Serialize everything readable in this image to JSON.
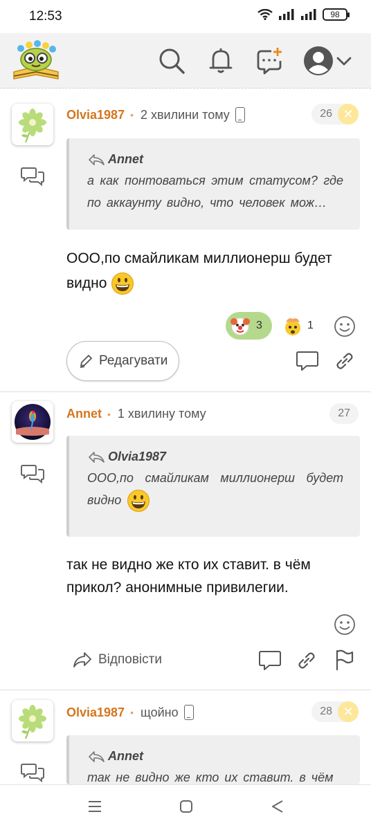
{
  "status_bar": {
    "time": "12:53",
    "battery": "98"
  },
  "header": {
    "icons": [
      "search-icon",
      "bell-icon",
      "new-post-icon",
      "account-icon",
      "chevron-down-icon"
    ]
  },
  "posts": [
    {
      "author": "Olvia1987",
      "time": "2 хвилини тому",
      "number": "26",
      "quote_author": "Annet",
      "quote_text": "а как понтоваться этим статусом? где по аккаунту видно, что человек мож…",
      "text": "ООО,по смайликам миллионерш будет видно",
      "reactions": [
        {
          "icon": "clown-face-icon",
          "count": "3"
        },
        {
          "icon": "exploding-head-icon",
          "count": "1"
        }
      ],
      "edit_label": "Редагувати"
    },
    {
      "author": "Annet",
      "time": "1 хвилину тому",
      "number": "27",
      "quote_author": "Olvia1987",
      "quote_text": "ООО,по смайликам миллионерш будет видно",
      "text": "так не видно же кто их ставит. в чём прикол? анонимные привилегии.",
      "reply_label": "Відповісти"
    },
    {
      "author": "Olvia1987",
      "time": "щойно",
      "number": "28",
      "quote_author": "Annet",
      "quote_text": "так не видно же кто их ставит. в чём"
    }
  ],
  "colors": {
    "username": "#d4761e",
    "reaction_pill": "#b4d98d",
    "delete_badge": "#fde79a"
  }
}
